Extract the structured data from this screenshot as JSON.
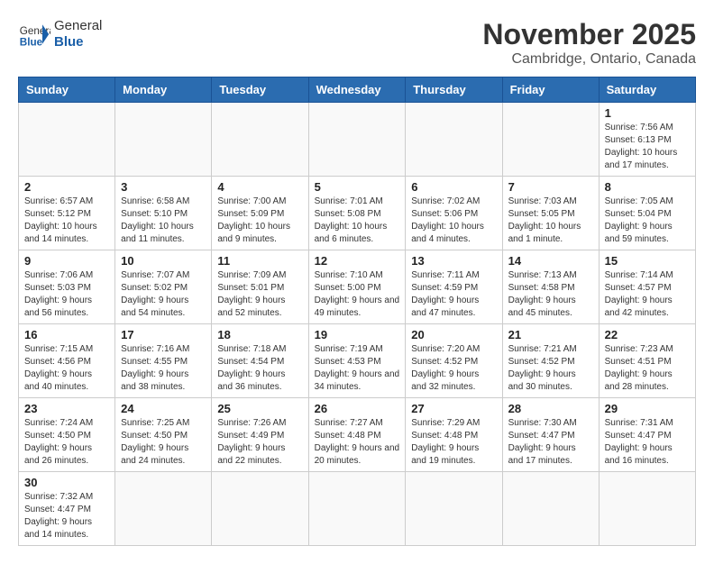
{
  "header": {
    "logo_text_normal": "General",
    "logo_text_bold": "Blue",
    "month": "November 2025",
    "location": "Cambridge, Ontario, Canada"
  },
  "weekdays": [
    "Sunday",
    "Monday",
    "Tuesday",
    "Wednesday",
    "Thursday",
    "Friday",
    "Saturday"
  ],
  "weeks": [
    [
      {
        "day": "",
        "info": ""
      },
      {
        "day": "",
        "info": ""
      },
      {
        "day": "",
        "info": ""
      },
      {
        "day": "",
        "info": ""
      },
      {
        "day": "",
        "info": ""
      },
      {
        "day": "",
        "info": ""
      },
      {
        "day": "1",
        "info": "Sunrise: 7:56 AM\nSunset: 6:13 PM\nDaylight: 10 hours\nand 17 minutes."
      }
    ],
    [
      {
        "day": "2",
        "info": "Sunrise: 6:57 AM\nSunset: 5:12 PM\nDaylight: 10 hours\nand 14 minutes."
      },
      {
        "day": "3",
        "info": "Sunrise: 6:58 AM\nSunset: 5:10 PM\nDaylight: 10 hours\nand 11 minutes."
      },
      {
        "day": "4",
        "info": "Sunrise: 7:00 AM\nSunset: 5:09 PM\nDaylight: 10 hours\nand 9 minutes."
      },
      {
        "day": "5",
        "info": "Sunrise: 7:01 AM\nSunset: 5:08 PM\nDaylight: 10 hours\nand 6 minutes."
      },
      {
        "day": "6",
        "info": "Sunrise: 7:02 AM\nSunset: 5:06 PM\nDaylight: 10 hours\nand 4 minutes."
      },
      {
        "day": "7",
        "info": "Sunrise: 7:03 AM\nSunset: 5:05 PM\nDaylight: 10 hours\nand 1 minute."
      },
      {
        "day": "8",
        "info": "Sunrise: 7:05 AM\nSunset: 5:04 PM\nDaylight: 9 hours\nand 59 minutes."
      }
    ],
    [
      {
        "day": "9",
        "info": "Sunrise: 7:06 AM\nSunset: 5:03 PM\nDaylight: 9 hours\nand 56 minutes."
      },
      {
        "day": "10",
        "info": "Sunrise: 7:07 AM\nSunset: 5:02 PM\nDaylight: 9 hours\nand 54 minutes."
      },
      {
        "day": "11",
        "info": "Sunrise: 7:09 AM\nSunset: 5:01 PM\nDaylight: 9 hours\nand 52 minutes."
      },
      {
        "day": "12",
        "info": "Sunrise: 7:10 AM\nSunset: 5:00 PM\nDaylight: 9 hours\nand 49 minutes."
      },
      {
        "day": "13",
        "info": "Sunrise: 7:11 AM\nSunset: 4:59 PM\nDaylight: 9 hours\nand 47 minutes."
      },
      {
        "day": "14",
        "info": "Sunrise: 7:13 AM\nSunset: 4:58 PM\nDaylight: 9 hours\nand 45 minutes."
      },
      {
        "day": "15",
        "info": "Sunrise: 7:14 AM\nSunset: 4:57 PM\nDaylight: 9 hours\nand 42 minutes."
      }
    ],
    [
      {
        "day": "16",
        "info": "Sunrise: 7:15 AM\nSunset: 4:56 PM\nDaylight: 9 hours\nand 40 minutes."
      },
      {
        "day": "17",
        "info": "Sunrise: 7:16 AM\nSunset: 4:55 PM\nDaylight: 9 hours\nand 38 minutes."
      },
      {
        "day": "18",
        "info": "Sunrise: 7:18 AM\nSunset: 4:54 PM\nDaylight: 9 hours\nand 36 minutes."
      },
      {
        "day": "19",
        "info": "Sunrise: 7:19 AM\nSunset: 4:53 PM\nDaylight: 9 hours\nand 34 minutes."
      },
      {
        "day": "20",
        "info": "Sunrise: 7:20 AM\nSunset: 4:52 PM\nDaylight: 9 hours\nand 32 minutes."
      },
      {
        "day": "21",
        "info": "Sunrise: 7:21 AM\nSunset: 4:52 PM\nDaylight: 9 hours\nand 30 minutes."
      },
      {
        "day": "22",
        "info": "Sunrise: 7:23 AM\nSunset: 4:51 PM\nDaylight: 9 hours\nand 28 minutes."
      }
    ],
    [
      {
        "day": "23",
        "info": "Sunrise: 7:24 AM\nSunset: 4:50 PM\nDaylight: 9 hours\nand 26 minutes."
      },
      {
        "day": "24",
        "info": "Sunrise: 7:25 AM\nSunset: 4:50 PM\nDaylight: 9 hours\nand 24 minutes."
      },
      {
        "day": "25",
        "info": "Sunrise: 7:26 AM\nSunset: 4:49 PM\nDaylight: 9 hours\nand 22 minutes."
      },
      {
        "day": "26",
        "info": "Sunrise: 7:27 AM\nSunset: 4:48 PM\nDaylight: 9 hours\nand 20 minutes."
      },
      {
        "day": "27",
        "info": "Sunrise: 7:29 AM\nSunset: 4:48 PM\nDaylight: 9 hours\nand 19 minutes."
      },
      {
        "day": "28",
        "info": "Sunrise: 7:30 AM\nSunset: 4:47 PM\nDaylight: 9 hours\nand 17 minutes."
      },
      {
        "day": "29",
        "info": "Sunrise: 7:31 AM\nSunset: 4:47 PM\nDaylight: 9 hours\nand 16 minutes."
      }
    ],
    [
      {
        "day": "30",
        "info": "Sunrise: 7:32 AM\nSunset: 4:47 PM\nDaylight: 9 hours\nand 14 minutes."
      },
      {
        "day": "",
        "info": ""
      },
      {
        "day": "",
        "info": ""
      },
      {
        "day": "",
        "info": ""
      },
      {
        "day": "",
        "info": ""
      },
      {
        "day": "",
        "info": ""
      },
      {
        "day": "",
        "info": ""
      }
    ]
  ]
}
